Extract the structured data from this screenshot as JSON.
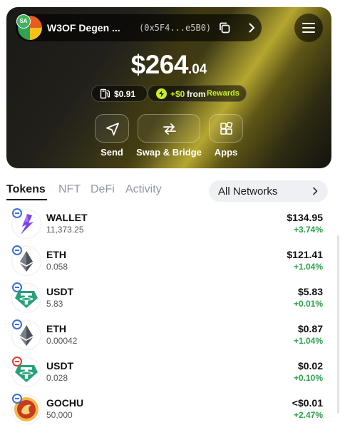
{
  "account": {
    "badge": "SA",
    "name": "W3OF Degen ...",
    "address": "(0x5F4...e5B0)"
  },
  "balance": {
    "integer": "$264",
    "decimal": ".04"
  },
  "gas": {
    "amount": "$0.91"
  },
  "rewards": {
    "amount": "+$0",
    "from": "from",
    "name": "Rewards"
  },
  "actions": [
    {
      "label": "Send"
    },
    {
      "label": "Swap & Bridge"
    },
    {
      "label": "Apps"
    }
  ],
  "tabs": [
    {
      "label": "Tokens"
    },
    {
      "label": "NFT"
    },
    {
      "label": "DeFi"
    },
    {
      "label": "Activity"
    }
  ],
  "network_filter": {
    "label": "All Networks"
  },
  "tokens": [
    {
      "symbol": "WALLET",
      "amount": "11,373.25",
      "value": "$134.95",
      "change": "+3.74%",
      "logo": "wallet-token-icon"
    },
    {
      "symbol": "ETH",
      "amount": "0.058",
      "value": "$121.41",
      "change": "+1.04%",
      "logo": "eth-icon"
    },
    {
      "symbol": "USDT",
      "amount": "5.83",
      "value": "$5.83",
      "change": "+0.01%",
      "logo": "usdt-icon"
    },
    {
      "symbol": "ETH",
      "amount": "0.00042",
      "value": "$0.87",
      "change": "+1.04%",
      "logo": "eth-icon"
    },
    {
      "symbol": "USDT",
      "amount": "0.028",
      "value": "$0.02",
      "change": "+0.10%",
      "logo": "usdt-icon"
    },
    {
      "symbol": "GOCHU",
      "amount": "50,000",
      "value": "<$0.01",
      "change": "+2.47%",
      "logo": "gochu-icon"
    }
  ],
  "colors": {
    "accent": "#c7f028",
    "positive": "#2aa24a",
    "usdt": "#26a17b",
    "wallet": "#7b3ff2"
  }
}
